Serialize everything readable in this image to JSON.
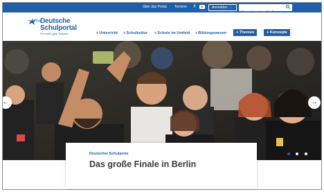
{
  "colors": {
    "brand": "#1f5ea8",
    "card_text": "#3a3a3a",
    "dot_active": "#ffffff",
    "dot_inactive": "#9ab3d3"
  },
  "topbar": {
    "links": [
      "Über das Portal",
      "Termine"
    ],
    "social_icons": [
      "facebook-icon",
      "youtube-icon"
    ],
    "login_label": "Anmelden",
    "login_icon": "user-icon",
    "search_placeholder": "Wonach suchen Sie?",
    "search_icon": "magnifier-icon"
  },
  "logo": {
    "pre": "Die",
    "line1": "Deutsche",
    "line2": "Schulportal",
    "tagline": "Für mehr gute Schulen",
    "icon": "bird-icon"
  },
  "nav": {
    "items": [
      "Unterricht",
      "Schulkultur",
      "Schule im Umfeld",
      "Bildungswesen"
    ],
    "buttons": [
      "Themen",
      "Konzepte"
    ]
  },
  "hero": {
    "prev_icon": "arrow-left-icon",
    "next_icon": "arrow-right-icon",
    "slides": 3,
    "active_slide": 1
  },
  "card": {
    "kicker": "Deutscher Schulpreis",
    "headline": "Das große Finale in Berlin"
  }
}
